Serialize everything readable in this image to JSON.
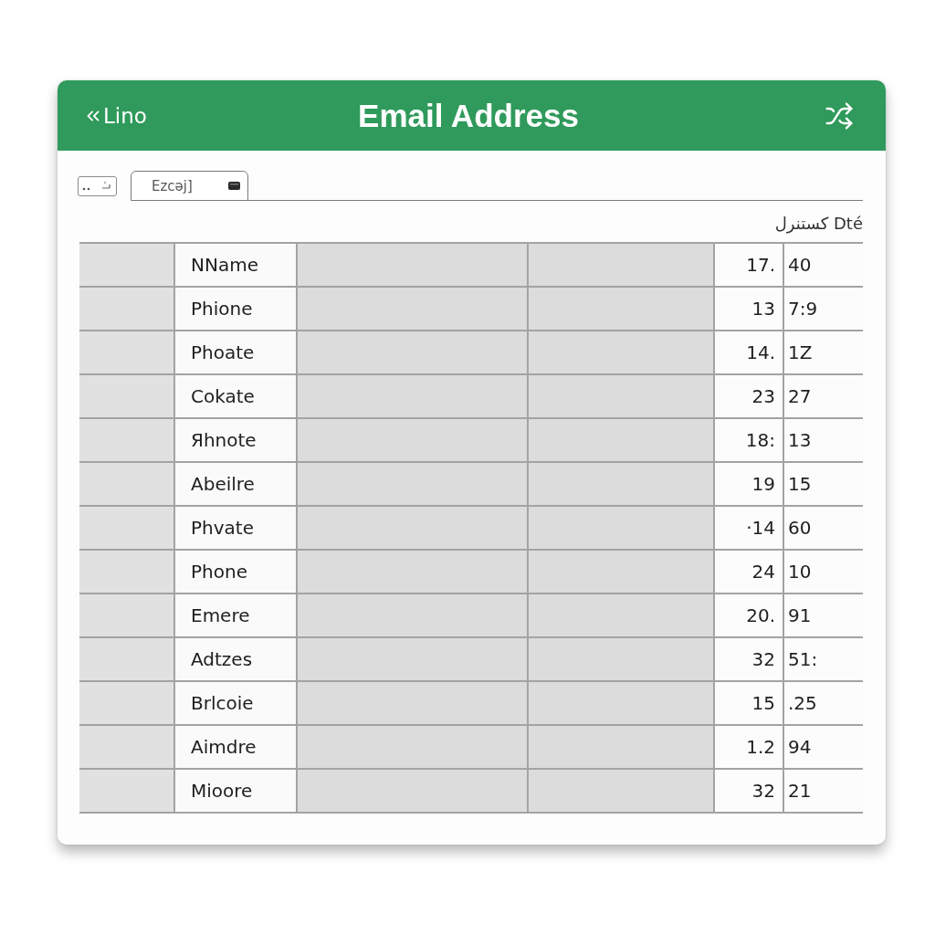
{
  "window": {
    "back_link": "Lino",
    "title": "Email Address"
  },
  "toolbar": {
    "field": {
      "placeholder": "Ezcəj]"
    }
  },
  "table": {
    "header_label": "كستنرل Dté",
    "rows": [
      {
        "column_2": "NName",
        "column_5": "17.",
        "column_6": "40"
      },
      {
        "column_2": "Phione",
        "column_5": "13",
        "column_6": "7:9"
      },
      {
        "column_2": "Phoate",
        "column_5": "14.",
        "column_6": "1Z"
      },
      {
        "column_2": "Cokate",
        "column_5": "23",
        "column_6": "27"
      },
      {
        "column_2": "Яhnote",
        "column_5": "18:",
        "column_6": "13"
      },
      {
        "column_2": "Abeilre",
        "column_5": "19",
        "column_6": "15"
      },
      {
        "column_2": "Phvate",
        "column_5": "·14",
        "column_6": "60"
      },
      {
        "column_2": "Phone",
        "column_5": "24",
        "column_6": "10"
      },
      {
        "column_2": "Emere",
        "column_5": "20.",
        "column_6": "91"
      },
      {
        "column_2": "Adtzes",
        "column_5": "32",
        "column_6": "51:"
      },
      {
        "column_2": "Brlcoie",
        "column_5": "15",
        "column_6": ".25"
      },
      {
        "column_2": "Aimdre",
        "column_5": "1.2",
        "column_6": "94"
      },
      {
        "column_2": "Mioore",
        "column_5": "32",
        "column_6": "21"
      }
    ]
  }
}
